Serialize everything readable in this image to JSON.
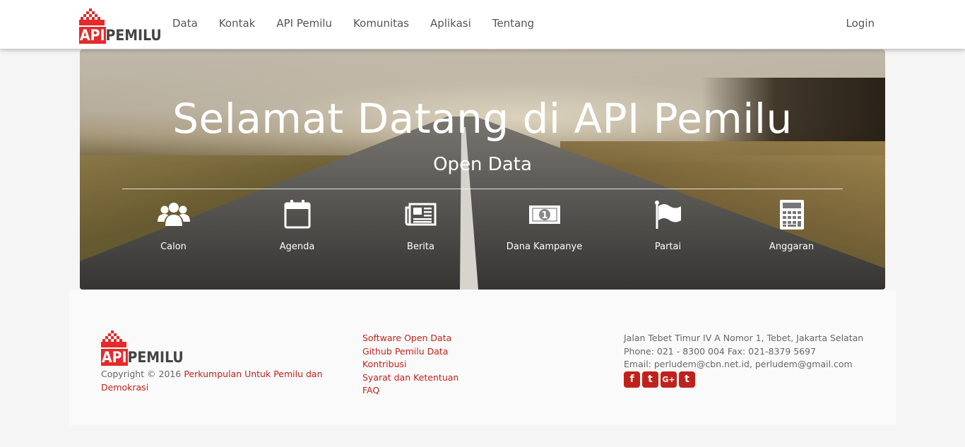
{
  "brand": {
    "logo_api": "API",
    "logo_pemilu": "PEMILU",
    "accent": "#e32b2b"
  },
  "nav": {
    "items": [
      {
        "label": "Data"
      },
      {
        "label": "Kontak"
      },
      {
        "label": "API Pemilu"
      },
      {
        "label": "Komunitas"
      },
      {
        "label": "Aplikasi"
      },
      {
        "label": "Tentang"
      }
    ],
    "login": "Login"
  },
  "hero": {
    "title": "Selamat Datang di API Pemilu",
    "subtitle": "Open Data",
    "features": [
      {
        "label": "Calon",
        "icon": "users-icon"
      },
      {
        "label": "Agenda",
        "icon": "calendar-icon"
      },
      {
        "label": "Berita",
        "icon": "newspaper-icon"
      },
      {
        "label": "Dana Kampanye",
        "icon": "money-icon"
      },
      {
        "label": "Partai",
        "icon": "flag-icon"
      },
      {
        "label": "Anggaran",
        "icon": "calculator-icon"
      }
    ]
  },
  "footer": {
    "copyright_prefix": "Copyright © 2016",
    "copyright_link": "Perkumpulan Untuk Pemilu dan Demokrasi",
    "links": [
      {
        "label": "Software Open Data"
      },
      {
        "label": "Github Pemilu Data"
      },
      {
        "label": "Kontribusi"
      },
      {
        "label": "Syarat dan Ketentuan"
      },
      {
        "label": "FAQ"
      }
    ],
    "address": "Jalan Tebet Timur IV A Nomor 1, Tebet, Jakarta Selatan",
    "phone": "Phone: 021 - 8300 004 Fax: 021-8379 5697",
    "email": "Email: perludem@cbn.net.id, perludem@gmail.com",
    "socials": [
      {
        "glyph": "f",
        "icon": "facebook-icon"
      },
      {
        "glyph": "t",
        "icon": "twitter-icon"
      },
      {
        "glyph": "G+",
        "icon": "google-plus-icon"
      },
      {
        "glyph": "t",
        "icon": "tumblr-icon"
      }
    ],
    "link_color": "#c0221b"
  }
}
